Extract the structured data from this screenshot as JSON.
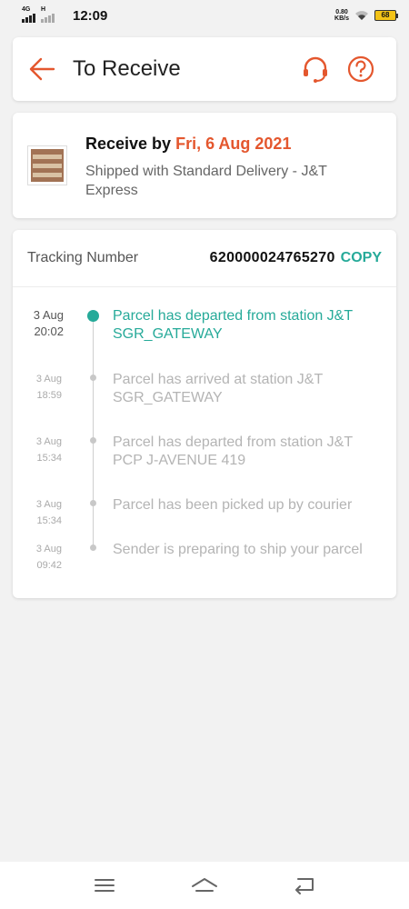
{
  "status_bar": {
    "network": "4G",
    "network2": "H",
    "time": "12:09",
    "speed_value": "0.80",
    "speed_unit": "KB/s",
    "battery": "68"
  },
  "header": {
    "title": "To Receive",
    "back_icon": "arrow-left-icon",
    "support_icon": "headset-icon",
    "help_icon": "question-circle-icon",
    "accent_color": "#e4572e"
  },
  "delivery": {
    "receive_label": "Receive by",
    "receive_date": "Fri, 6 Aug 2021",
    "shipped_text": "Shipped with Standard Delivery  - J&T Express"
  },
  "tracking": {
    "label": "Tracking Number",
    "number": "620000024765270",
    "copy_label": "COPY",
    "accent_color": "#26aa99",
    "events": [
      {
        "date": "3 Aug",
        "time": "20:02",
        "text": "Parcel has departed from station J&T SGR_GATEWAY",
        "active": true
      },
      {
        "date": "3 Aug",
        "time": "18:59",
        "text": "Parcel has arrived at station J&T SGR_GATEWAY",
        "active": false
      },
      {
        "date": "3 Aug",
        "time": "15:34",
        "text": "Parcel has departed from station J&T PCP J-AVENUE 419",
        "active": false
      },
      {
        "date": "3 Aug",
        "time": "15:34",
        "text": "Parcel has been picked up by courier",
        "active": false
      },
      {
        "date": "3 Aug",
        "time": "09:42",
        "text": "Sender is preparing to ship your parcel",
        "active": false
      }
    ]
  },
  "nav": {
    "menu_icon": "menu-icon",
    "home_icon": "home-icon",
    "back_icon": "back-icon"
  }
}
